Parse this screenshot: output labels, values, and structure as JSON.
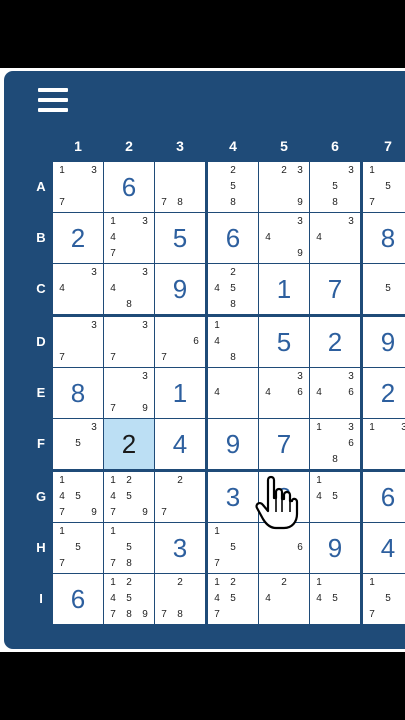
{
  "columns": [
    "1",
    "2",
    "3",
    "4",
    "5",
    "6",
    "7"
  ],
  "rows": [
    "A",
    "B",
    "C",
    "D",
    "E",
    "F",
    "G",
    "H",
    "I"
  ],
  "colors": {
    "panel": "#1f4b78",
    "given": "#2d5f9e",
    "selected": "#bcdff4"
  },
  "menu_icon": "hamburger-menu-icon",
  "cursor_icon": "hand-pointer-icon",
  "selected_cell": "F2",
  "grid": [
    [
      {
        "c": [
          1,
          3,
          7
        ]
      },
      {
        "v": "6"
      },
      {
        "c": [
          7,
          8
        ]
      },
      {
        "c": [
          2,
          5,
          8
        ]
      },
      {
        "c": [
          2,
          3,
          9
        ]
      },
      {
        "c": [
          3,
          5,
          8
        ]
      },
      {
        "c": [
          1,
          5,
          7
        ]
      }
    ],
    [
      {
        "v": "2"
      },
      {
        "c": [
          1,
          3,
          4,
          7
        ]
      },
      {
        "v": "5"
      },
      {
        "v": "6"
      },
      {
        "c": [
          3,
          4,
          9
        ]
      },
      {
        "c": [
          3,
          4
        ]
      },
      {
        "v": "8"
      }
    ],
    [
      {
        "c": [
          3,
          4
        ]
      },
      {
        "c": [
          3,
          4,
          8
        ]
      },
      {
        "v": "9"
      },
      {
        "c": [
          2,
          4,
          5,
          8
        ]
      },
      {
        "v": "1"
      },
      {
        "v": "7"
      },
      {
        "c": [
          5
        ]
      }
    ],
    [
      {
        "c": [
          3,
          7
        ]
      },
      {
        "c": [
          3,
          7
        ]
      },
      {
        "c": [
          6,
          7
        ]
      },
      {
        "c": [
          1,
          4,
          8
        ]
      },
      {
        "v": "5"
      },
      {
        "v": "2"
      },
      {
        "v": "9"
      }
    ],
    [
      {
        "v": "8"
      },
      {
        "c": [
          3,
          7,
          9
        ]
      },
      {
        "v": "1"
      },
      {
        "c": [
          4
        ]
      },
      {
        "c": [
          3,
          4,
          6
        ]
      },
      {
        "c": [
          3,
          4,
          6
        ]
      },
      {
        "v": "2"
      }
    ],
    [
      {
        "c": [
          3,
          5
        ]
      },
      {
        "v": "2"
      },
      {
        "v": "4"
      },
      {
        "v": "9"
      },
      {
        "v": "7"
      },
      {
        "c": [
          1,
          3,
          6,
          8
        ]
      },
      {
        "c": [
          1,
          3
        ]
      }
    ],
    [
      {
        "c": [
          1,
          4,
          5,
          7,
          9
        ]
      },
      {
        "c": [
          1,
          2,
          4,
          5,
          7,
          9
        ]
      },
      {
        "c": [
          2,
          7
        ]
      },
      {
        "v": "3"
      },
      {
        "v": "8"
      },
      {
        "c": [
          1,
          4,
          5
        ]
      },
      {
        "v": "6"
      }
    ],
    [
      {
        "c": [
          1,
          5,
          7
        ]
      },
      {
        "c": [
          1,
          5,
          7,
          8
        ]
      },
      {
        "v": "3"
      },
      {
        "c": [
          1,
          5,
          7
        ]
      },
      {
        "c": [
          6
        ]
      },
      {
        "v": "9"
      },
      {
        "v": "4"
      }
    ],
    [
      {
        "v": "6"
      },
      {
        "c": [
          1,
          2,
          4,
          5,
          7,
          8,
          9
        ]
      },
      {
        "c": [
          2,
          7,
          8
        ]
      },
      {
        "c": [
          1,
          2,
          4,
          5,
          7
        ]
      },
      {
        "c": [
          2,
          4
        ]
      },
      {
        "c": [
          1,
          4,
          5
        ]
      },
      {
        "c": [
          1,
          5,
          7
        ]
      }
    ]
  ]
}
